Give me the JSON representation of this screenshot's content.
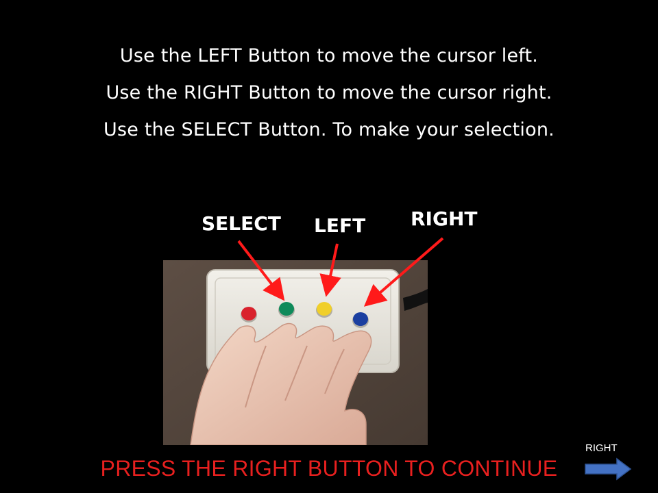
{
  "instructions": [
    "Use the LEFT Button to move the cursor left.",
    "Use the RIGHT Button to move the cursor right.",
    "Use the SELECT Button. To make your selection."
  ],
  "button_labels": {
    "select": "SELECT",
    "left": "LEFT",
    "right": "RIGHT"
  },
  "photo": {
    "button_colors": [
      "#d9222d",
      "#0f8a5a",
      "#f0cf2a",
      "#1b3fa0"
    ],
    "arrow_color": "#ff1a1a"
  },
  "continue_message": "PRESS THE RIGHT BUTTON TO CONTINUE",
  "nav": {
    "right_label": "RIGHT",
    "arrow_color": "#4472c4"
  },
  "colors": {
    "background": "#000000",
    "text": "#ffffff",
    "continue_text": "#e8201f"
  }
}
